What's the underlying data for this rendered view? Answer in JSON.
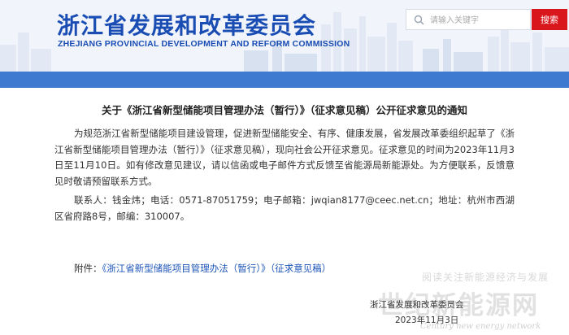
{
  "header": {
    "title_cn": "浙江省发展和改革委员会",
    "title_en": "ZHEJIANG PROVINCIAL DEVELOPMENT AND REFORM COMMISSION",
    "search_placeholder": "请输入关键字",
    "search_button": "搜索",
    "band_color": "#3e7bd0",
    "brand_color": "#1a4db3",
    "search_button_color": "#d9161b"
  },
  "article": {
    "title": "关于《浙江省新型储能项目管理办法（暂行）》（征求意见稿）公开征求意见的通知",
    "paragraph1": "为规范浙江省新型储能项目建设管理，促进新型储能安全、有序、健康发展，省发展改革委组织起草了《浙江省新型储能项目管理办法（暂行）》（征求意见稿），现向社会公开征求意见。征求意见的时间为2023年11月3日至11月10日。如有修改意见建议，请以信函或电子邮件方式反馈至省能源局新能源处。为方便联系，反馈意见时敬请预留联系方式。",
    "paragraph2": "联系人：钱金炜；电话：0571-87051759；电子邮箱：jwqian8177@ceec.net.cn；地址：杭州市西湖区省府路8号，邮编：310007。",
    "attachment_prefix": "附件：",
    "attachment_link": "《浙江省新型储能项目管理办法（暂行）》（征求意见稿）",
    "signature_org": "浙江省发展和改革委员会",
    "signature_date": "2023年11月3日"
  },
  "watermark": {
    "top": "阅读关注新能源经济与发展",
    "logo": "世纪新能源网",
    "sub": "Century new energy network"
  }
}
